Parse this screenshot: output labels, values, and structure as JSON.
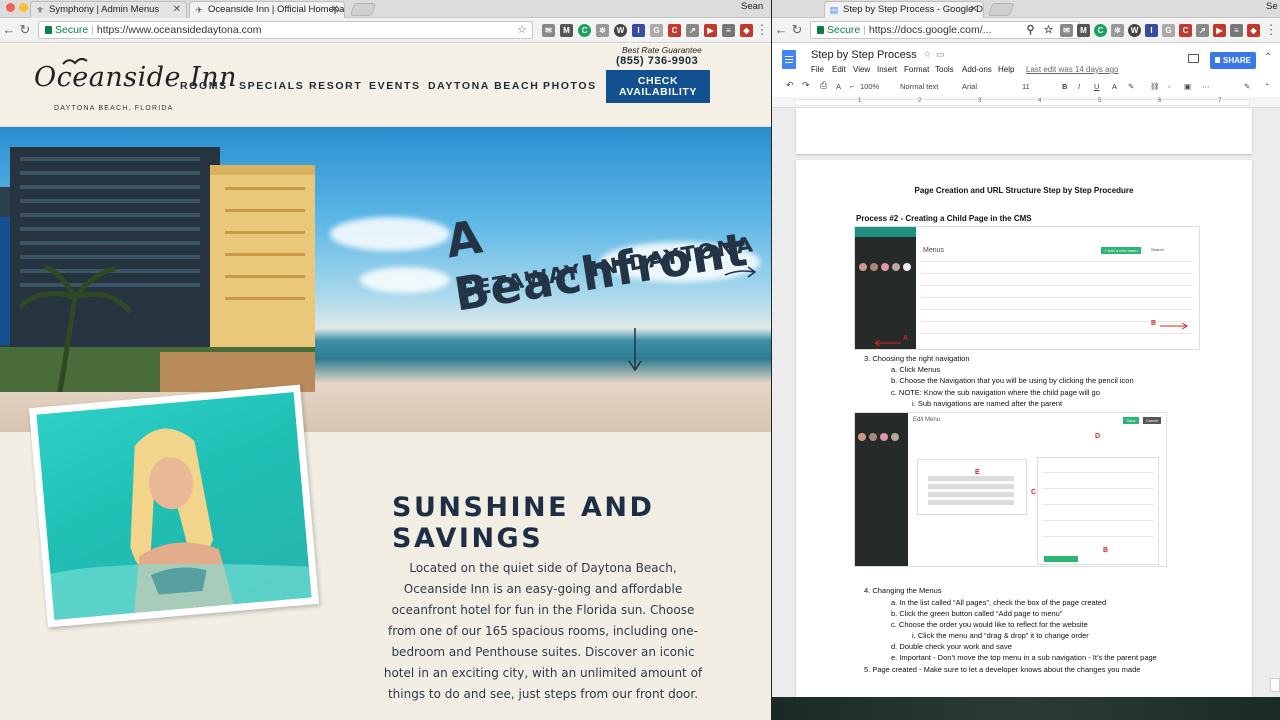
{
  "left_browser": {
    "tabs": [
      {
        "title": "Symphony | Admin Menus",
        "icon": "symphony-favicon"
      },
      {
        "title": "Oceanside Inn | Official Homepage",
        "icon": "oceanside-favicon"
      }
    ],
    "user": "Sean",
    "secure_label": "Secure",
    "url": "https://www.oceansidedaytona.com"
  },
  "site": {
    "logo": "Oceanside Inn",
    "logo_sub": "DAYTONA BEACH, FLORIDA",
    "nav": [
      "ROOMS",
      "SPECIALS",
      "RESORT",
      "EVENTS",
      "DAYTONA BEACH",
      "PHOTOS"
    ],
    "best_rate": "Best Rate Guarantee",
    "phone": "(855) 736-9903",
    "cta_line1": "CHECK",
    "cta_line2": "AVAILABILITY",
    "hero_line1": "A Beachfront",
    "hero_line2": "GETAWAY IN DAYTONA",
    "headline": "SUNSHINE AND SAVINGS",
    "body": "Located on the quiet side of Daytona Beach, Oceanside Inn is an easy-going and affordable oceanfront hotel for fun in the Florida sun. Choose from one of our 165 spacious rooms, including one-bedroom and Penthouse suites. Discover an iconic hotel in an exciting city, with an unlimited amount of things to do and see, just steps from our front door."
  },
  "right_browser": {
    "tab_title": "Step by Step Process - Google Docs",
    "user": "Se",
    "secure_label": "Secure",
    "url": "https://docs.google.com/..."
  },
  "docs": {
    "title": "Step by Step Process",
    "menu": [
      "File",
      "Edit",
      "View",
      "Insert",
      "Format",
      "Tools",
      "Add-ons",
      "Help"
    ],
    "last_edit": "Last edit was 14 days ago",
    "share": "SHARE",
    "zoom": "100%",
    "style": "Normal text",
    "font": "Arial",
    "size": "11",
    "heading": "Page Creation and URL Structure Step by Step Procedure",
    "process_title": "Process #2 - Creating a Child Page in the CMS",
    "shot1": {
      "title": "Menus",
      "button": "+ Add a new menu",
      "search": "Search"
    },
    "shot2": {
      "title": "Edit Menu",
      "save": "Save",
      "cancel": "Cancel"
    },
    "lines": [
      "3.      Choosing the right navigation",
      "a.    Click Menus",
      "b.    Choose the Navigation that you will be using by clicking the pencil icon",
      "c.    NOTE: Know the sub navigation where the child page will go",
      "i.       Sub navigations are named after the parent",
      "4.  Changing the Menus",
      "a.    In the list called “All pages”, check the box of the page created",
      "b.    Click the green button called “Add page to menu”",
      "c.    Choose the order you would like to reflect for the website",
      "i.       Click the menu and “drag & drop” it to change order",
      "d.    Double check your work and save",
      "e.    Important - Don’t move the top menu in a sub navigation - It’s the parent page",
      "5. Page created - Make sure to let a developer knows about the changes you made"
    ],
    "ruler": [
      "1",
      "2",
      "3",
      "4",
      "5",
      "6",
      "7"
    ],
    "markers": [
      "A",
      "B",
      "C",
      "D",
      "E"
    ]
  }
}
